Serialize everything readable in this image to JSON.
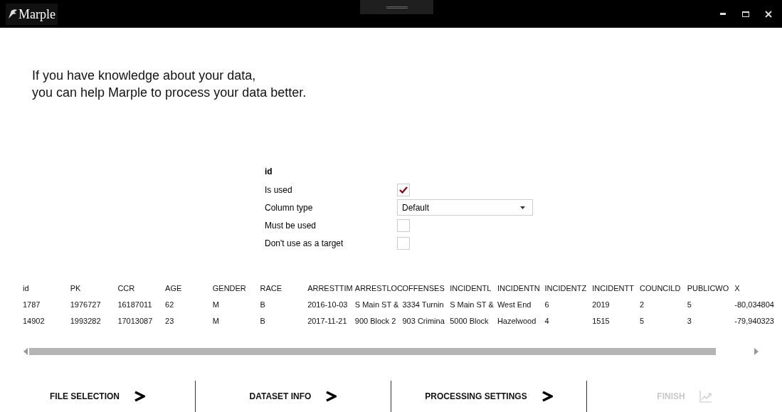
{
  "window": {
    "title": "Marple"
  },
  "intro": [
    "If you have knowledge about your data,",
    "you can help Marple to process your data better."
  ],
  "column_settings": {
    "column_name": "id",
    "fields": [
      {
        "kind": "checkbox",
        "label": "Is used",
        "checked": true
      },
      {
        "kind": "dropdown",
        "label": "Column type",
        "value": "Default"
      },
      {
        "kind": "checkbox",
        "label": "Must be used",
        "checked": false
      },
      {
        "kind": "checkbox",
        "label": "Don't use as a target",
        "checked": false
      }
    ]
  },
  "table": {
    "columns": [
      "id",
      "PK",
      "CCR",
      "AGE",
      "GENDER",
      "RACE",
      "ARRESTTIM",
      "ARRESTLOC",
      "OFFENSES",
      "INCIDENTL",
      "INCIDENTN",
      "INCIDENTZ",
      "INCIDENTT",
      "COUNCILD",
      "PUBLICWO",
      "X"
    ],
    "rows": [
      [
        "1787",
        "1976727",
        "16187011",
        "62",
        "M",
        "B",
        "2016-10-03",
        "S Main ST &",
        "3334 Turnin",
        "S Main ST &",
        "West End",
        "6",
        "2019",
        "2",
        "5",
        "-80,034804"
      ],
      [
        "14902",
        "1993282",
        "17013087",
        "23",
        "M",
        "B",
        "2017-11-21",
        "900 Block 2",
        "903 Crimina",
        "5000 Block",
        "Hazelwood",
        "4",
        "1515",
        "5",
        "3",
        "-79,940323"
      ]
    ]
  },
  "steps": [
    {
      "label": "FILE SELECTION",
      "kind": "next",
      "disabled": false
    },
    {
      "label": "DATASET INFO",
      "kind": "next",
      "disabled": false
    },
    {
      "label": "PROCESSING SETTINGS",
      "kind": "next",
      "disabled": false
    },
    {
      "label": "FINISH",
      "kind": "finish",
      "disabled": true
    }
  ]
}
